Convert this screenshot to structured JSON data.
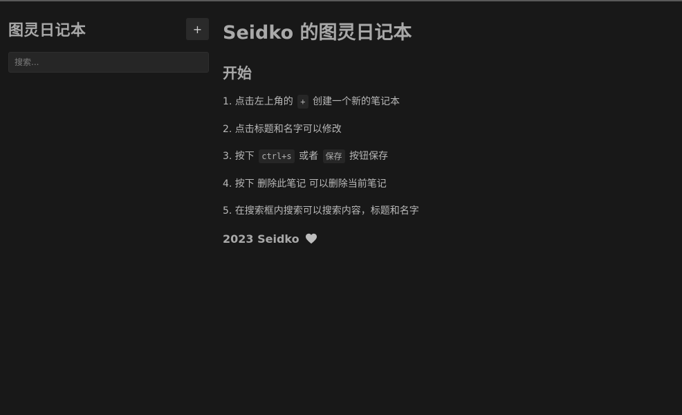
{
  "sidebar": {
    "title": "图灵日记本",
    "add_label": "+",
    "search_placeholder": "搜索..."
  },
  "main": {
    "title": "Seidko 的图灵日记本",
    "section": "开始",
    "steps": [
      {
        "prefix": "1. 点击左上角的",
        "code": "+",
        "suffix": "创建一个新的笔记本"
      },
      {
        "text": "2. 点击标题和名字可以修改"
      },
      {
        "prefix": "3. 按下",
        "code": "ctrl+s",
        "middle": "或者",
        "code2": "保存",
        "suffix": "按钮保存"
      },
      {
        "text": "4. 按下 删除此笔记 可以删除当前笔记"
      },
      {
        "text": "5. 在搜索框内搜索可以搜索内容，标题和名字"
      }
    ],
    "footer": "2023 Seidko",
    "footer_icon": "heart-icon",
    "heart_color": "#bdbdbd"
  }
}
